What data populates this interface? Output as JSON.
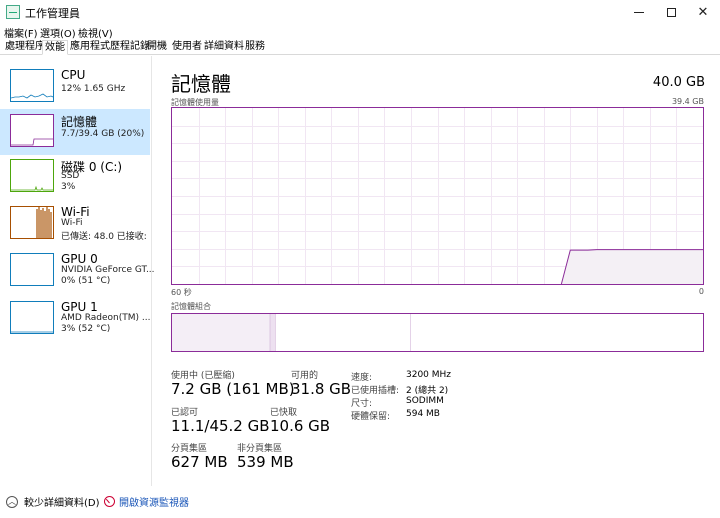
{
  "window": {
    "title": "工作管理員"
  },
  "menu": [
    "檔案(F)",
    "選項(O)",
    "檢視(V)"
  ],
  "tabs": [
    {
      "label": "處理程序",
      "active": false
    },
    {
      "label": "效能",
      "active": true
    },
    {
      "label": "應用程式歷程記錄",
      "active": false
    },
    {
      "label": "開機",
      "active": false
    },
    {
      "label": "使用者",
      "active": false
    },
    {
      "label": "詳細資料",
      "active": false
    },
    {
      "label": "服務",
      "active": false
    }
  ],
  "sidebar": {
    "items": [
      {
        "title": "CPU",
        "sub1": "12%  1.65 GHz",
        "sub2": "",
        "color": "#117dbb"
      },
      {
        "title": "記憶體",
        "sub1": "7.7/39.4 GB (20%)",
        "sub2": "",
        "color": "#8b2c99"
      },
      {
        "title": "磁碟 0 (C:)",
        "sub1": "SSD",
        "sub2": "3%",
        "color": "#4da60c"
      },
      {
        "title": "Wi-Fi",
        "sub1": "Wi-Fi",
        "sub2": "已傳送: 48.0  已接收: 79",
        "color": "#a74f01"
      },
      {
        "title": "GPU 0",
        "sub1": "NVIDIA GeForce GT...",
        "sub2": "0% (51 °C)",
        "color": "#117dbb"
      },
      {
        "title": "GPU 1",
        "sub1": "AMD Radeon(TM) ...",
        "sub2": "3% (52 °C)",
        "color": "#117dbb"
      }
    ]
  },
  "main": {
    "title": "記憶體",
    "total": "40.0 GB",
    "chart_label": "記憶體使用量",
    "chart_max": "39.4 GB",
    "time_left": "60 秒",
    "time_right": "0",
    "composition_label": "記憶體組合",
    "stats": {
      "in_use_label": "使用中 (已壓縮)",
      "in_use_value": "7.2 GB (161 MB)",
      "available_label": "可用的",
      "available_value": "31.8 GB",
      "committed_label": "已認可",
      "committed_value": "11.1/45.2 GB",
      "cached_label": "已快取",
      "cached_value": "10.6 GB",
      "paged_label": "分頁集區",
      "paged_value": "627 MB",
      "nonpaged_label": "非分頁集區",
      "nonpaged_value": "539 MB"
    },
    "info": [
      {
        "label": "速度:",
        "value": "3200 MHz"
      },
      {
        "label": "已使用插槽:",
        "value": "2 (總共 2)"
      },
      {
        "label": "尺寸:",
        "value": "SODIMM"
      },
      {
        "label": "硬體保留:",
        "value": "594 MB"
      }
    ]
  },
  "chart_data": {
    "type": "area",
    "ylim": [
      0,
      39.4
    ],
    "x_range_seconds": [
      60,
      0
    ],
    "series": [
      {
        "values": [
          0,
          0,
          0,
          0,
          0,
          0,
          0,
          0,
          0,
          0,
          0,
          0,
          0,
          0,
          0,
          0,
          0,
          0,
          0,
          0,
          0,
          0,
          0,
          0,
          0,
          0,
          0,
          0,
          0,
          0,
          0,
          0,
          0,
          0,
          0,
          0,
          0,
          0,
          0,
          0,
          0,
          0,
          0,
          0,
          0,
          7.6,
          7.6,
          7.6,
          7.7,
          7.7,
          7.7,
          7.7,
          7.7,
          7.7,
          7.7,
          7.7,
          7.7,
          7.7,
          7.7,
          7.7,
          7.7
        ]
      }
    ]
  },
  "composition": {
    "in_use_fraction": 0.185,
    "modified_fraction": 0.01,
    "standby_fraction": 0.255,
    "free_fraction": 0.55
  },
  "bottom": {
    "fewer_details": "較少詳細資料(D)",
    "resource_monitor": "開啟資源監視器"
  },
  "colors": {
    "memory": "#8b2c99",
    "grid": "#f1e6f3",
    "fill": "#f4f0f5"
  }
}
